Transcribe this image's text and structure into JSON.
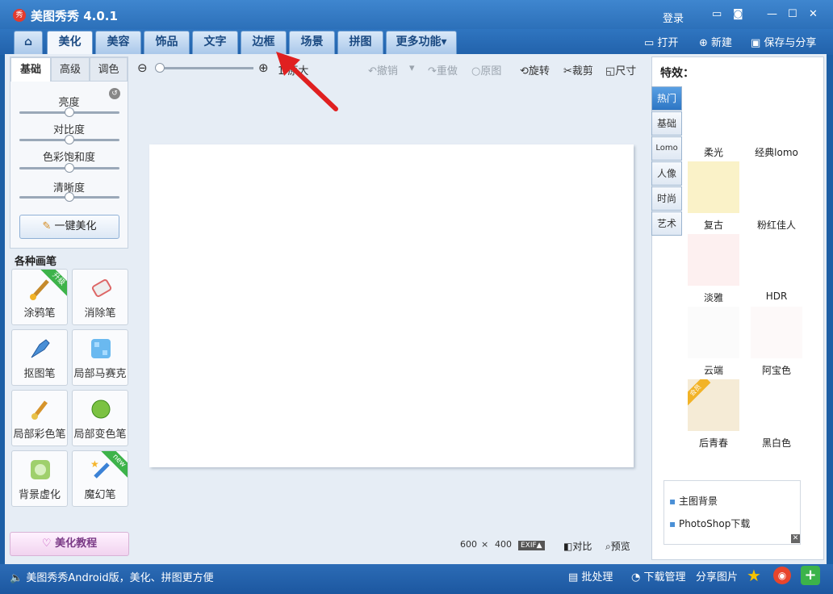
{
  "app": {
    "title": "美图秀秀 4.0.1",
    "logo_char": "秀"
  },
  "titlebar": {
    "login": "登录"
  },
  "tabs": [
    {
      "label": "美化",
      "active": true
    },
    {
      "label": "美容"
    },
    {
      "label": "饰品"
    },
    {
      "label": "文字"
    },
    {
      "label": "边框"
    },
    {
      "label": "场景"
    },
    {
      "label": "拼图"
    },
    {
      "label": "更多功能▾"
    }
  ],
  "top_actions": {
    "open": "打开",
    "new": "新建",
    "save_share": "保存与分享"
  },
  "left": {
    "subtabs": [
      "基础",
      "高级",
      "调色"
    ],
    "sliders": [
      {
        "label": "亮度",
        "value": 0.5
      },
      {
        "label": "对比度",
        "value": 0.5
      },
      {
        "label": "色彩饱和度",
        "value": 0.5
      },
      {
        "label": "清晰度",
        "value": 0.5
      }
    ],
    "one_key": "一键美化",
    "brushes_title": "各种画笔",
    "brushes": [
      {
        "label": "涂鸦笔",
        "badge": "升级"
      },
      {
        "label": "消除笔"
      },
      {
        "label": "抠图笔"
      },
      {
        "label": "局部马赛克"
      },
      {
        "label": "局部彩色笔"
      },
      {
        "label": "局部变色笔"
      },
      {
        "label": "背景虚化"
      },
      {
        "label": "魔幻笔",
        "badge": "new"
      }
    ],
    "tutorial": "美化教程"
  },
  "toolbar": {
    "zoom_label": "原大",
    "undo": "撤销",
    "redo": "重做",
    "original": "原图",
    "rotate": "旋转",
    "crop": "裁剪",
    "size": "尺寸"
  },
  "canvas": {
    "width_text": "600",
    "times": "×",
    "height_text": "400",
    "exif": "EXIF▲",
    "compare": "对比",
    "preview": "预览"
  },
  "right": {
    "title": "特效：",
    "categories": [
      {
        "label": "热门",
        "active": true
      },
      {
        "label": "基础"
      },
      {
        "label": "Lomo"
      },
      {
        "label": "人像"
      },
      {
        "label": "时尚"
      },
      {
        "label": "艺术"
      }
    ],
    "effects": [
      {
        "label": "柔光",
        "color": "#ffffff"
      },
      {
        "label": "经典lomo",
        "color": "#ffffff"
      },
      {
        "label": "复古",
        "color": "#faf2c8"
      },
      {
        "label": "粉红佳人",
        "color": "#ffffff"
      },
      {
        "label": "淡雅",
        "color": "#fdf0f0"
      },
      {
        "label": "HDR",
        "color": "#ffffff"
      },
      {
        "label": "云端",
        "color": "#fbfbfb"
      },
      {
        "label": "阿宝色",
        "color": "#fdf9f9"
      },
      {
        "label": "后青春",
        "color": "#f5ebd6",
        "badge": "会员"
      },
      {
        "label": "黑白色",
        "color": "#ffffff"
      }
    ],
    "news": [
      "主图背景",
      "PhotoShop下载"
    ]
  },
  "statusbar": {
    "promo": "美图秀秀Android版，美化、拼图更方便",
    "batch": "批处理",
    "download": "下载管理",
    "share": "分享图片"
  },
  "colors": {
    "accent": "#2b6fb8",
    "arrow": "#e02020"
  }
}
